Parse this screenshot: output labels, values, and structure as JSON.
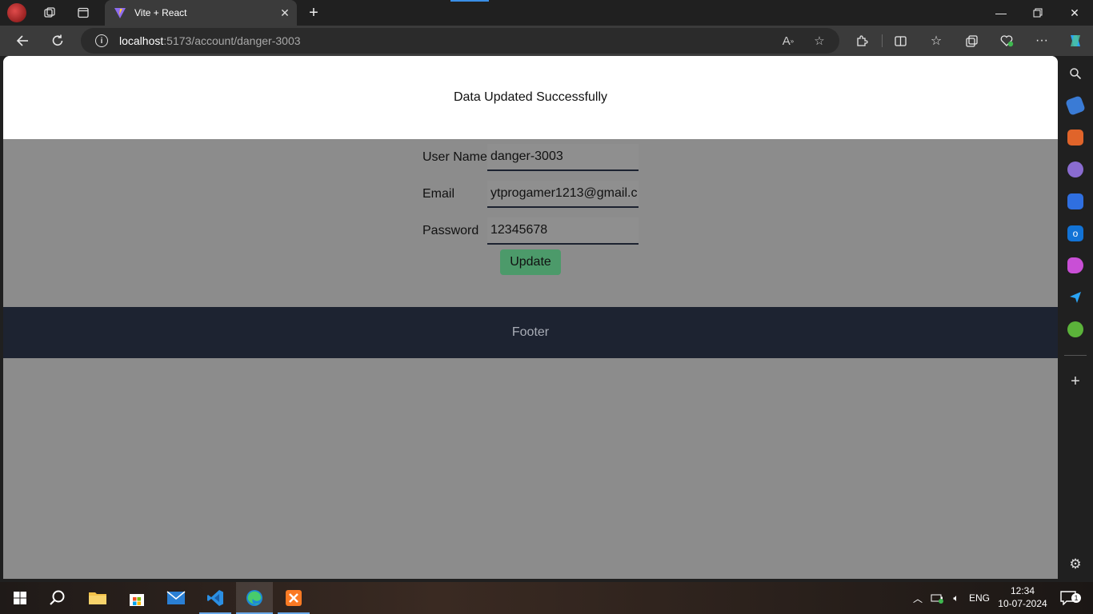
{
  "browser": {
    "tab_title": "Vite + React",
    "url_host": "localhost",
    "url_path": ":5173/account/danger-3003"
  },
  "page": {
    "toast_message": "Data Updated Successfully",
    "form": {
      "username_label": "User Name",
      "username_value": "danger-3003",
      "email_label": "Email",
      "email_value": "ytprogamer1213@gmail.c",
      "password_label": "Password",
      "password_value": "12345678",
      "update_label": "Update"
    },
    "footer_text": "Footer"
  },
  "taskbar": {
    "language": "ENG",
    "time": "12:34",
    "date": "10-07-2024",
    "notification_count": "1"
  },
  "colors": {
    "page_bg": "#8c8c8c",
    "footer_bg": "#1d2331",
    "button_bg": "#4c9a6a"
  }
}
